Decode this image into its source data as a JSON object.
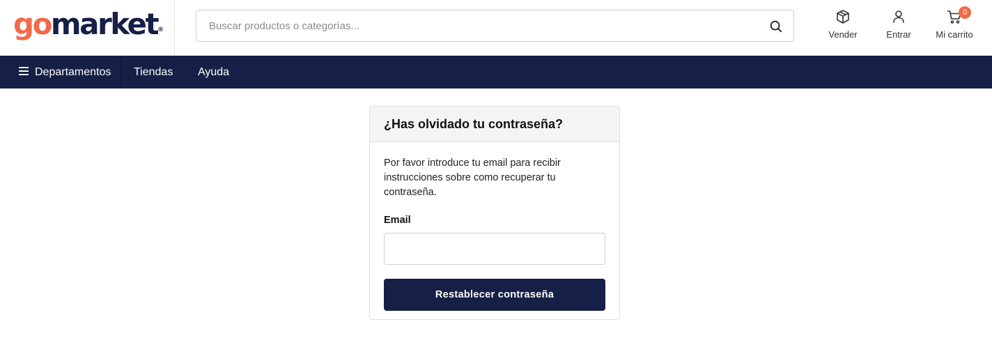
{
  "brand": {
    "logo_part_a": "go",
    "logo_part_b": "market",
    "logo_reg": "®",
    "primary_color": "#161f45",
    "accent_color": "#f26a4b"
  },
  "header": {
    "search": {
      "placeholder": "Buscar productos o categorías...",
      "icon": "search-icon"
    },
    "actions": [
      {
        "label": "Vender",
        "icon": "box-icon"
      },
      {
        "label": "Entrar",
        "icon": "user-icon"
      },
      {
        "label": "Mi carrito",
        "icon": "cart-icon",
        "badge": "0"
      }
    ]
  },
  "nav": {
    "items": [
      {
        "label": "Departamentos",
        "icon": "menu-icon"
      },
      {
        "label": "Tiendas"
      },
      {
        "label": "Ayuda"
      }
    ]
  },
  "form": {
    "title": "¿Has olvidado tu contraseña?",
    "description": "Por favor introduce tu email para recibir instrucciones sobre como recuperar tu contraseña.",
    "email_label": "Email",
    "email_value": "",
    "submit_label": "Restablecer contraseña"
  }
}
